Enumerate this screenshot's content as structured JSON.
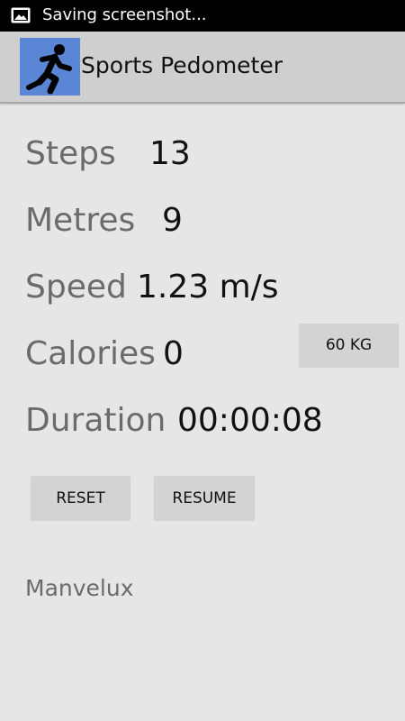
{
  "status_bar": {
    "icon": "image-icon",
    "text": "Saving screenshot..."
  },
  "action_bar": {
    "icon": "runner-icon",
    "icon_color": "#5b86d6",
    "title": "Sports Pedometer"
  },
  "stats": {
    "steps": {
      "label": "Steps",
      "value": "13"
    },
    "metres": {
      "label": "Metres",
      "value": "9"
    },
    "speed": {
      "label": "Speed",
      "value": "1.23 m/s"
    },
    "calories": {
      "label": "Calories",
      "value": "0"
    },
    "duration": {
      "label": "Duration",
      "value": "00:00:08"
    }
  },
  "buttons": {
    "weight_label": "60 KG",
    "reset_label": "RESET",
    "resume_label": "RESUME"
  },
  "footer": {
    "text": "Manvelux"
  }
}
